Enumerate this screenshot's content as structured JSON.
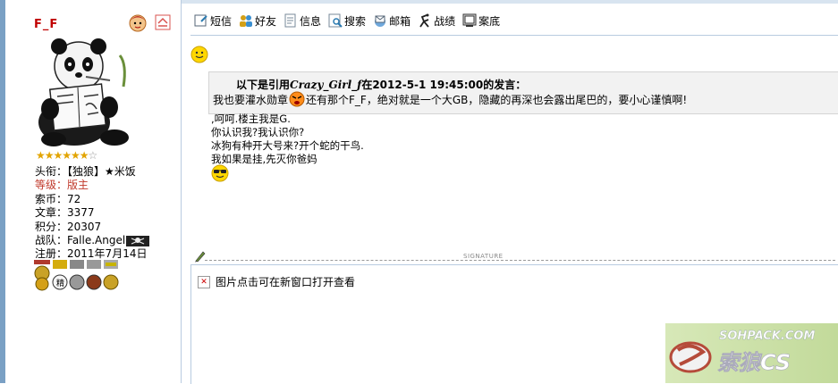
{
  "user": {
    "name": "F_F",
    "stars_filled": 6,
    "stars_total": 7,
    "info": [
      {
        "label": "头衔：",
        "value": "【独狼】★米饭",
        "red": false
      },
      {
        "label": "等级：",
        "value": "版主",
        "red": true
      },
      {
        "label": "索币：",
        "value": "72",
        "red": false
      },
      {
        "label": "文章：",
        "value": "3377",
        "red": false
      },
      {
        "label": "积分：",
        "value": "20307",
        "red": false
      },
      {
        "label": "战队：",
        "value": "Falle.Angel",
        "red": false
      },
      {
        "label": "注册：",
        "value": "2011年7月14日",
        "red": false
      }
    ]
  },
  "toolbar": {
    "items": [
      {
        "label": "短信",
        "icon": "message-icon"
      },
      {
        "label": "好友",
        "icon": "friends-icon"
      },
      {
        "label": "信息",
        "icon": "info-icon"
      },
      {
        "label": "搜索",
        "icon": "search-icon"
      },
      {
        "label": "邮箱",
        "icon": "mail-icon"
      },
      {
        "label": "战绩",
        "icon": "stats-icon"
      },
      {
        "label": "案底",
        "icon": "record-icon"
      }
    ]
  },
  "quote": {
    "prefix": "以下是引用",
    "author": "Crazy_Girl_f",
    "suffix": "在2012-5-1 19:45:00的发言：",
    "body_part1": "我也要灌水勋章",
    "body_part2": "还有那个F_F，绝对就是一个大GB，隐藏的再深也会露出尾巴的，要小心谨慎啊!"
  },
  "reply": {
    "lines": [
      ",呵呵.楼主我是G.",
      "你认识我?我认识你?",
      "冰狗有种开大号来?开个蛇的干鸟.",
      "我如果是挂,先灭你爸妈"
    ]
  },
  "signature": {
    "label": "SIGNATURE",
    "broken_image_text": "图片点击可在新窗口打开查看"
  },
  "logo": {
    "url_text": "SOHPACK.COM",
    "name_text": "索狼CS"
  },
  "colors": {
    "accent": "#7aa0c4",
    "rank_red": "#c0392b",
    "username_red": "#c00000",
    "star": "#e2a400"
  }
}
